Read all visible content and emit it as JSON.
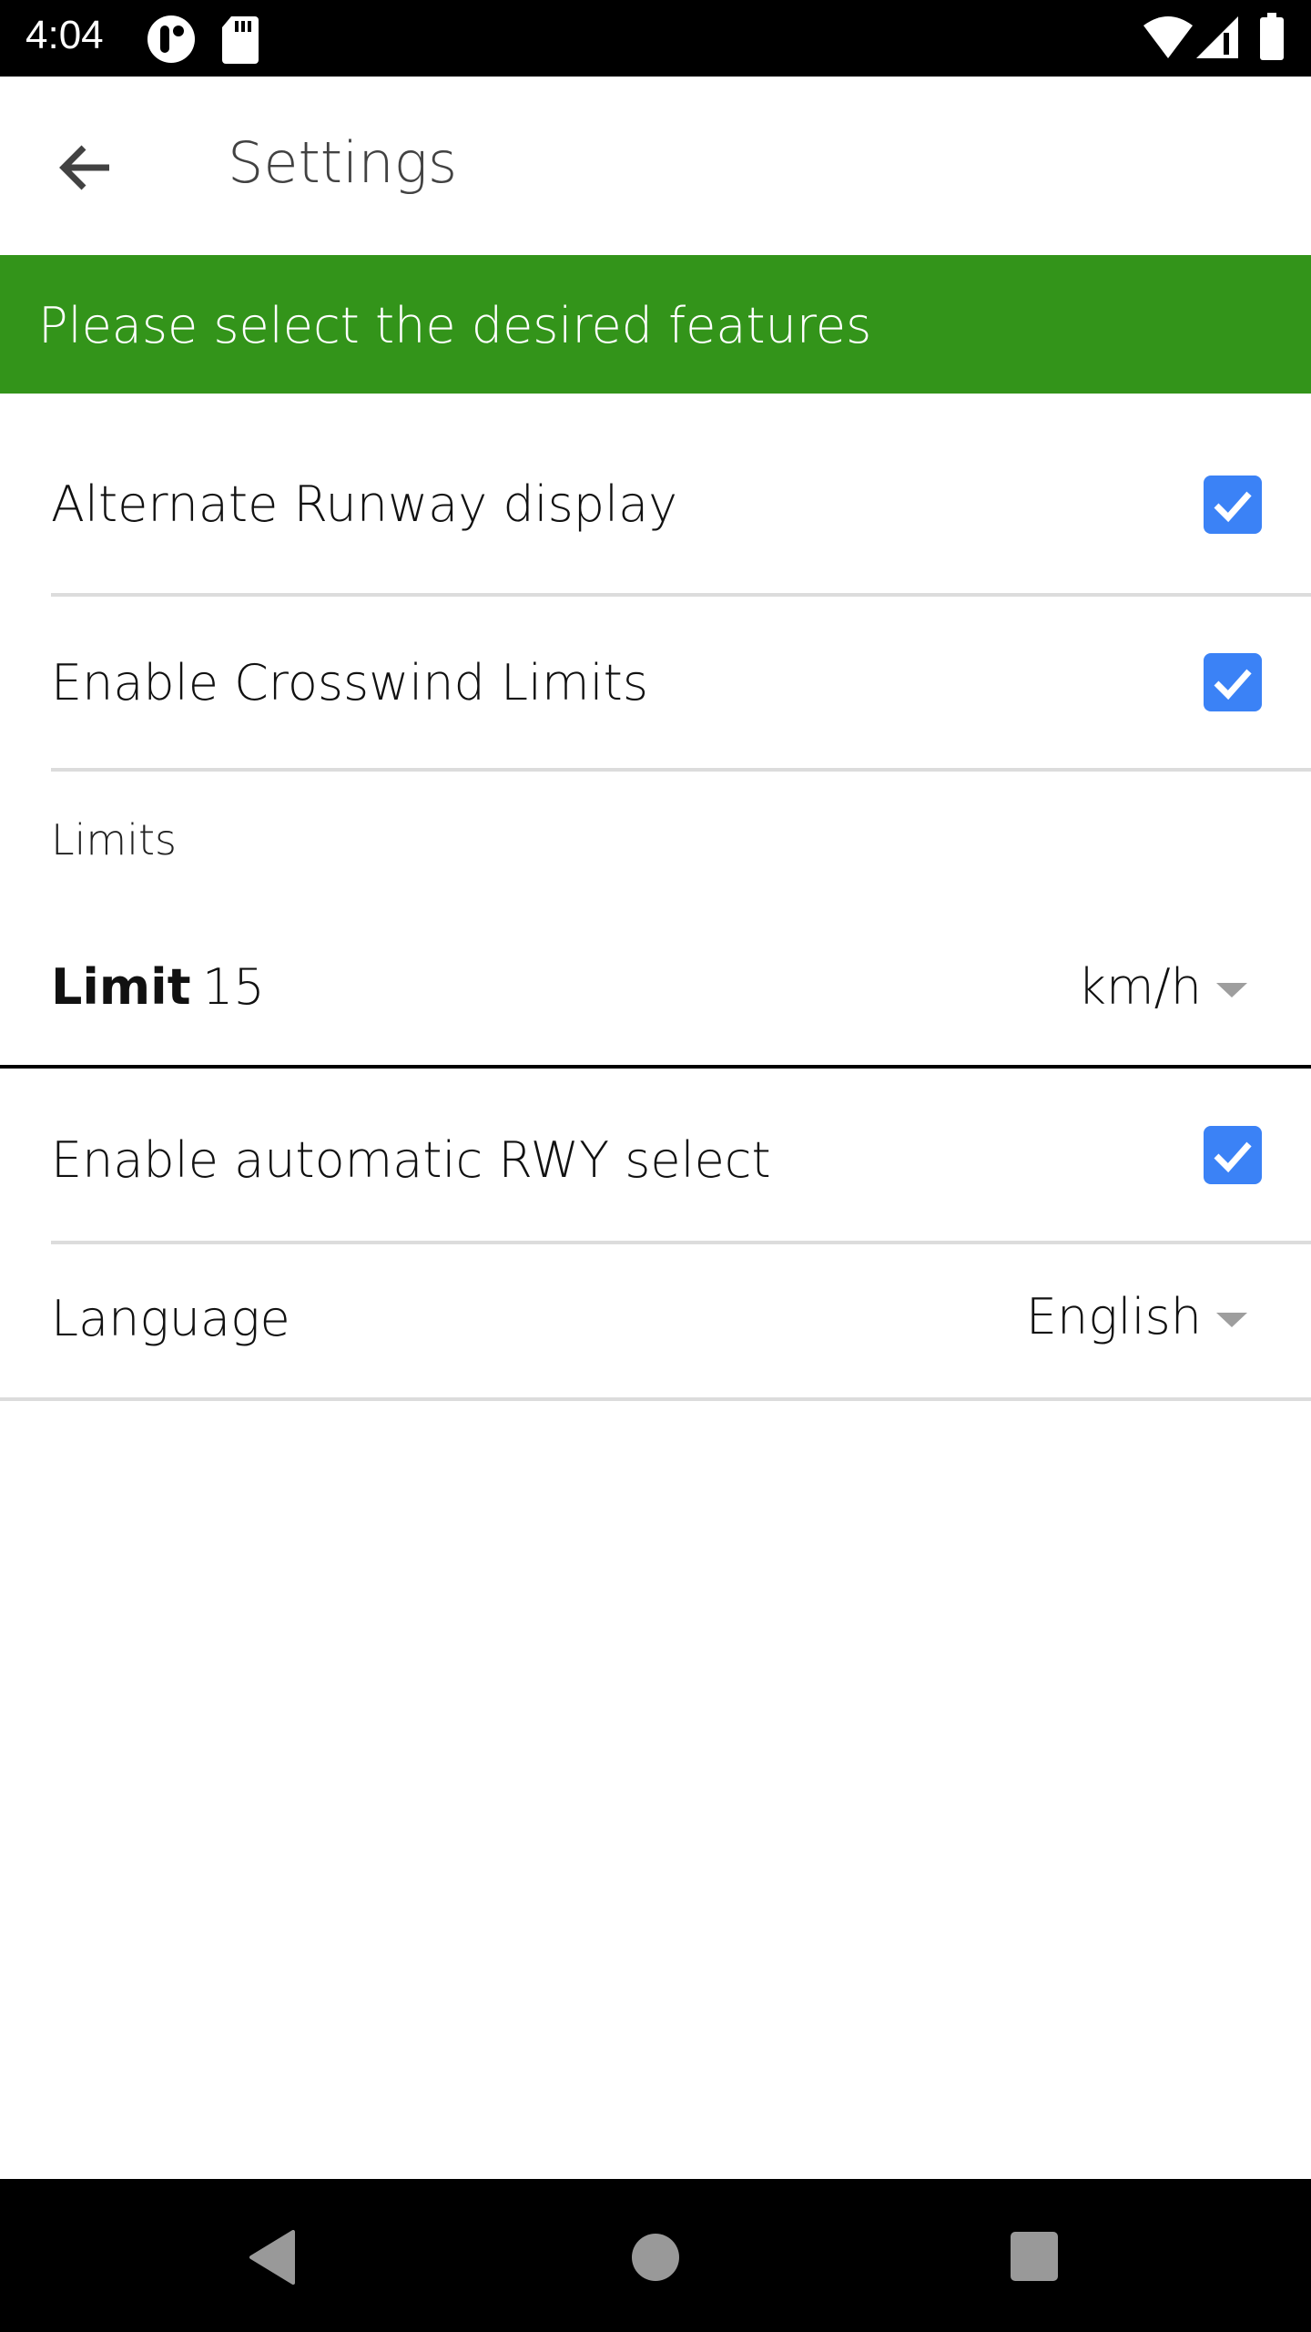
{
  "status_bar": {
    "time": "4:04",
    "left_icons": [
      "app-notification-icon",
      "sd-card-icon"
    ],
    "right_icons": [
      "wifi-icon",
      "cell-signal-icon",
      "battery-icon"
    ]
  },
  "app_bar": {
    "back_icon": "arrow-left-icon",
    "title": "Settings"
  },
  "banner": {
    "text": "Please select the desired features",
    "color": "#33941A"
  },
  "settings": {
    "alternate_runway": {
      "label": "Alternate Runway display",
      "checked": true
    },
    "crosswind_limits": {
      "label": "Enable Crosswind Limits",
      "checked": true
    },
    "limits_section": {
      "header": "Limits",
      "limit_label": "Limit",
      "limit_value": "15",
      "unit": "km/h"
    },
    "auto_rwy_select": {
      "label": "Enable automatic RWY select",
      "checked": true
    },
    "language": {
      "label": "Language",
      "value": "English"
    }
  },
  "colors": {
    "checkbox": "#3B82F6",
    "dropdown_arrow": "#9E9E9E"
  },
  "nav_bar": {
    "buttons": [
      "back-icon",
      "home-icon",
      "recents-icon"
    ]
  }
}
